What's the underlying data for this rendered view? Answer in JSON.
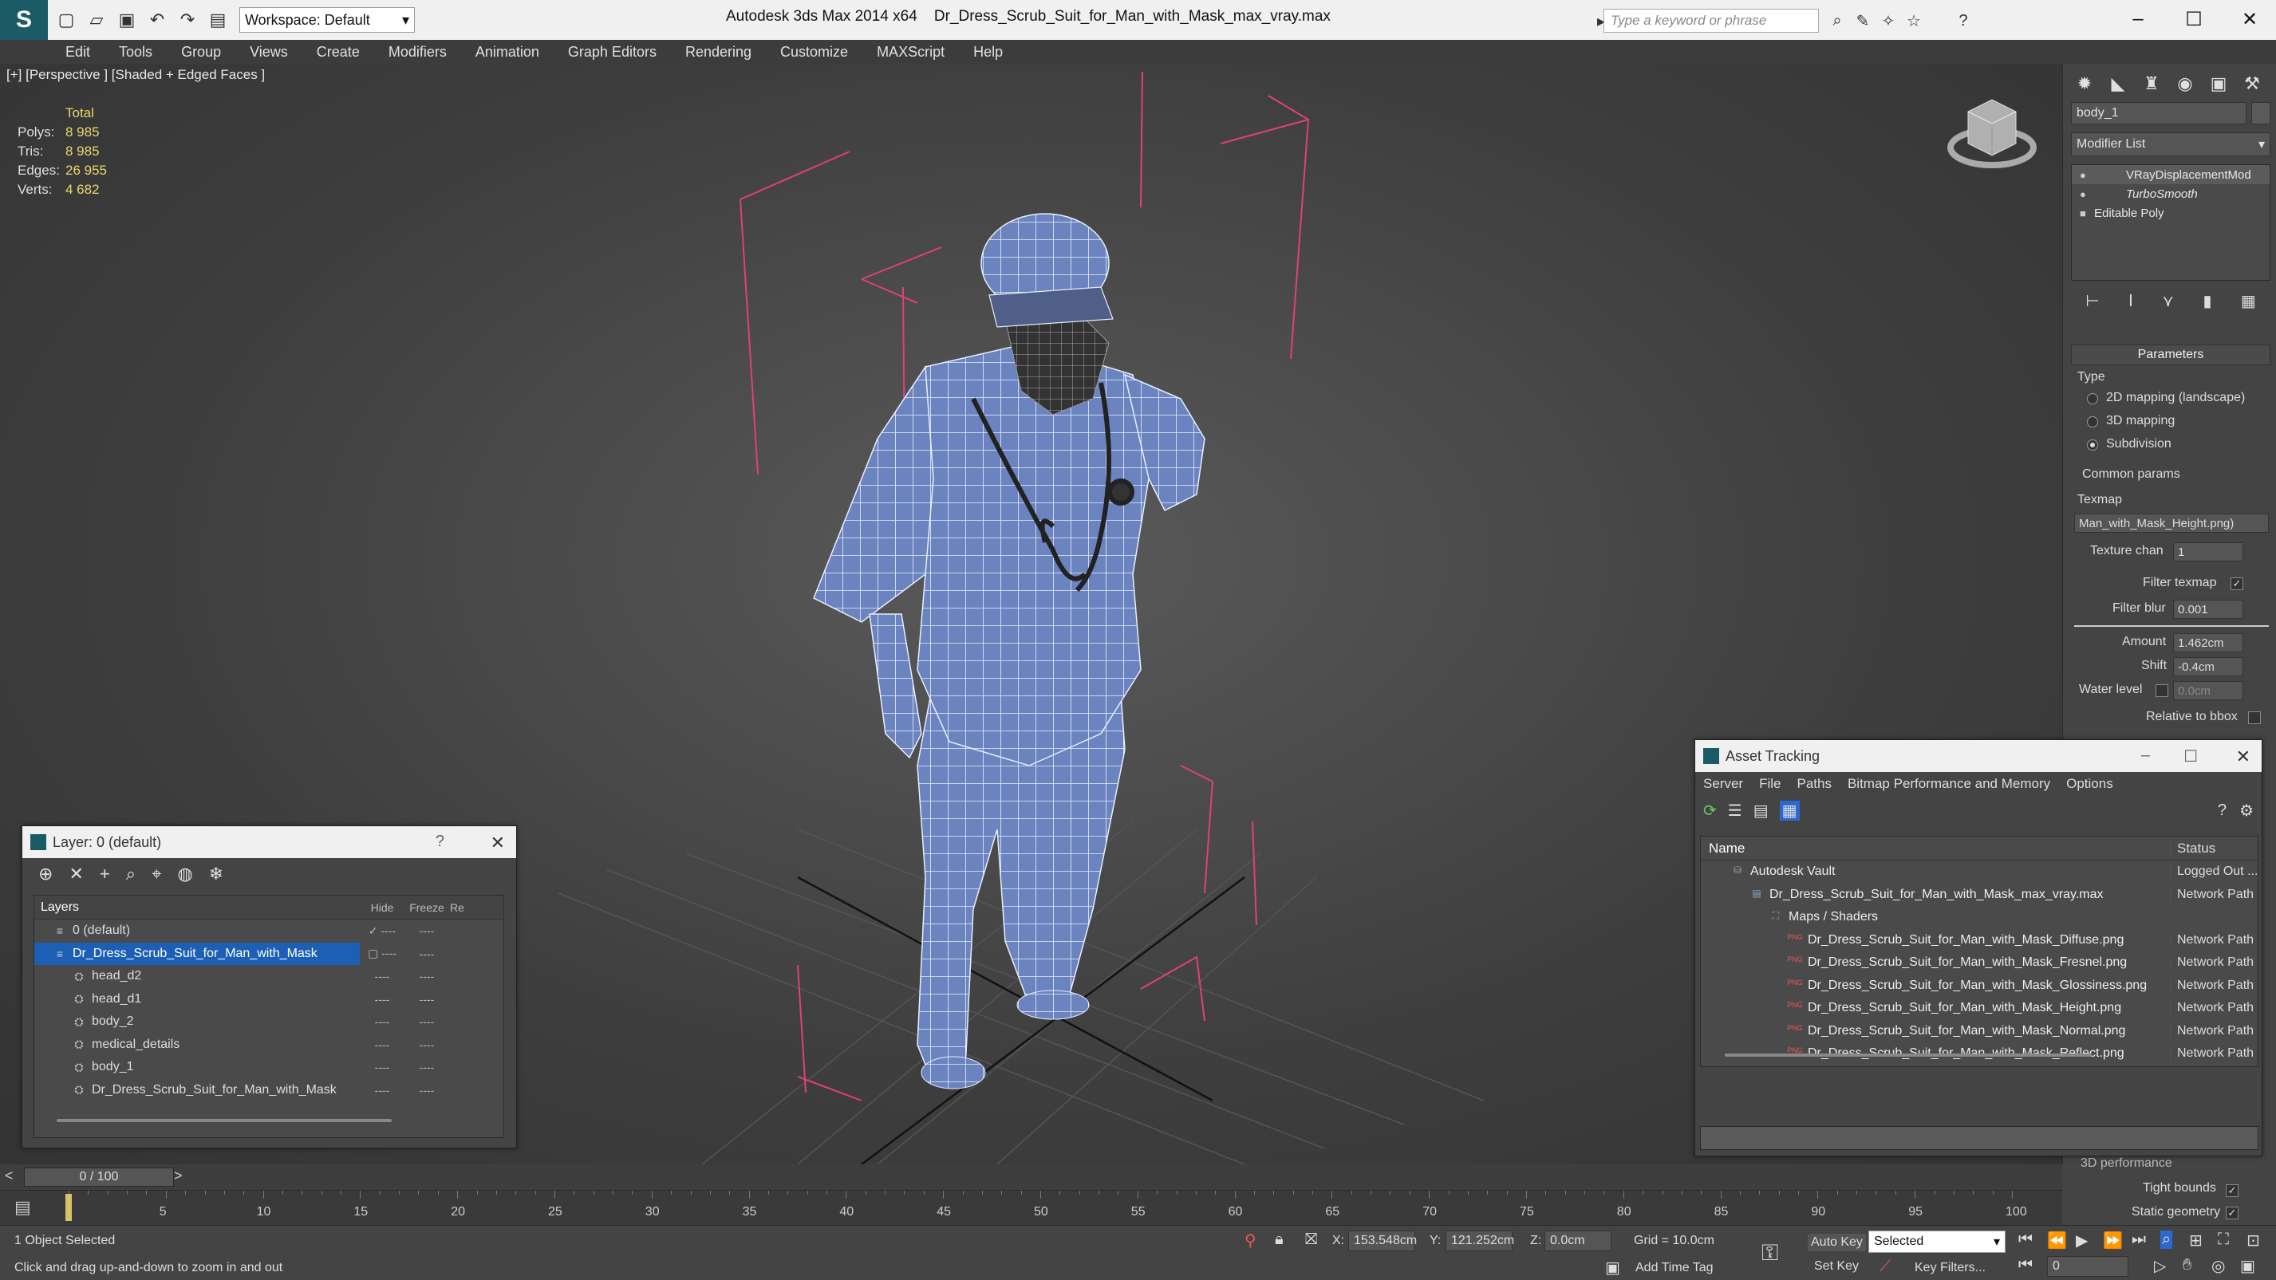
{
  "app": {
    "logo": "S",
    "workspace": "Workspace: Default",
    "title": "Autodesk 3ds Max  2014 x64",
    "filename": "Dr_Dress_Scrub_Suit_for_Man_with_Mask_max_vray.max",
    "search_placeholder": "Type a keyword or phrase"
  },
  "menu": [
    "Edit",
    "Tools",
    "Group",
    "Views",
    "Create",
    "Modifiers",
    "Animation",
    "Graph Editors",
    "Rendering",
    "Customize",
    "MAXScript",
    "Help"
  ],
  "viewport": {
    "label": "[+] [Perspective ] [Shaded + Edged Faces ]",
    "stats": {
      "total": "Total",
      "rows": [
        {
          "label": "Polys:",
          "value": "8 985"
        },
        {
          "label": "Tris:",
          "value": "8 985"
        },
        {
          "label": "Edges:",
          "value": "26 955"
        },
        {
          "label": "Verts:",
          "value": "4 682"
        }
      ]
    }
  },
  "command_panel": {
    "object_name": "body_1",
    "modifier_list": "Modifier List",
    "stack": [
      "VRayDisplacementMod",
      "TurboSmooth",
      "Editable Poly"
    ],
    "params_title": "Parameters",
    "type_label": "Type",
    "type_options": [
      "2D mapping (landscape)",
      "3D mapping",
      "Subdivision"
    ],
    "common_params": "Common params",
    "texmap_label": "Texmap",
    "texmap_value": "Man_with_Mask_Height.png)",
    "texture_chan_label": "Texture chan",
    "texture_chan_value": "1",
    "filter_texmap": "Filter texmap",
    "filter_blur_label": "Filter blur",
    "filter_blur_value": "0.001",
    "amount_label": "Amount",
    "amount_value": "1.462cm",
    "shift_label": "Shift",
    "shift_value": "-0.4cm",
    "water_level_label": "Water level",
    "water_level_value": "0.0cm",
    "relative_bbox": "Relative to bbox",
    "perf_label": "3D performance",
    "tight_bounds": "Tight bounds",
    "static_geometry": "Static geometry"
  },
  "layer_window": {
    "title": "Layer: 0 (default)",
    "help": "?",
    "columns": [
      "Layers",
      "Hide",
      "Freeze",
      "Re"
    ],
    "rows": [
      {
        "name": "0 (default)",
        "indent": 0
      },
      {
        "name": "Dr_Dress_Scrub_Suit_for_Man_with_Mask",
        "indent": 0
      },
      {
        "name": "head_d2",
        "indent": 1
      },
      {
        "name": "head_d1",
        "indent": 1
      },
      {
        "name": "body_2",
        "indent": 1
      },
      {
        "name": "medical_details",
        "indent": 1
      },
      {
        "name": "body_1",
        "indent": 1
      },
      {
        "name": "Dr_Dress_Scrub_Suit_for_Man_with_Mask",
        "indent": 1
      }
    ],
    "dash": "----"
  },
  "asset_window": {
    "title": "Asset Tracking",
    "menu": [
      "Server",
      "File",
      "Paths",
      "Bitmap Performance and Memory",
      "Options"
    ],
    "columns": [
      "Name",
      "Status"
    ],
    "rows": [
      {
        "name": "Autodesk Vault",
        "status": "Logged Out ...",
        "level": 1,
        "icon": "vault"
      },
      {
        "name": "Dr_Dress_Scrub_Suit_for_Man_with_Mask_max_vray.max",
        "status": "Network Path",
        "level": 2,
        "icon": "max"
      },
      {
        "name": "Maps / Shaders",
        "status": "",
        "level": 3,
        "icon": "maps"
      },
      {
        "name": "Dr_Dress_Scrub_Suit_for_Man_with_Mask_Diffuse.png",
        "status": "Network Path",
        "level": 4,
        "icon": "png"
      },
      {
        "name": "Dr_Dress_Scrub_Suit_for_Man_with_Mask_Fresnel.png",
        "status": "Network Path",
        "level": 4,
        "icon": "png"
      },
      {
        "name": "Dr_Dress_Scrub_Suit_for_Man_with_Mask_Glossiness.png",
        "status": "Network Path",
        "level": 4,
        "icon": "png"
      },
      {
        "name": "Dr_Dress_Scrub_Suit_for_Man_with_Mask_Height.png",
        "status": "Network Path",
        "level": 4,
        "icon": "png"
      },
      {
        "name": "Dr_Dress_Scrub_Suit_for_Man_with_Mask_Normal.png",
        "status": "Network Path",
        "level": 4,
        "icon": "png"
      },
      {
        "name": "Dr_Dress_Scrub_Suit_for_Man_with_Mask_Reflect.png",
        "status": "Network Path",
        "level": 4,
        "icon": "png"
      }
    ],
    "png_badge": "PNG"
  },
  "timeline": {
    "frame": "0 / 100",
    "ticks": [
      0,
      5,
      10,
      15,
      20,
      25,
      30,
      35,
      40,
      45,
      50,
      55,
      60,
      65,
      70,
      75,
      80,
      85,
      90,
      95,
      100
    ]
  },
  "status": {
    "selection": "1 Object Selected",
    "prompt": "Click and drag up-and-down to zoom in and out",
    "x_label": "X:",
    "x_value": "153.548cm",
    "y_label": "Y:",
    "y_value": "121.252cm",
    "z_label": "Z:",
    "z_value": "0.0cm",
    "grid": "Grid = 10.0cm",
    "auto_key": "Auto Key",
    "set_key": "Set Key",
    "selected": "Selected",
    "key_filters": "Key Filters...",
    "add_time_tag": "Add Time Tag",
    "current_frame": "0"
  },
  "colors": {
    "selection_blue": "#1d5fb5",
    "stat_yellow": "#e8d76a",
    "mesh_blue": "#6b84c0",
    "bbox_pink": "#e0407a"
  }
}
